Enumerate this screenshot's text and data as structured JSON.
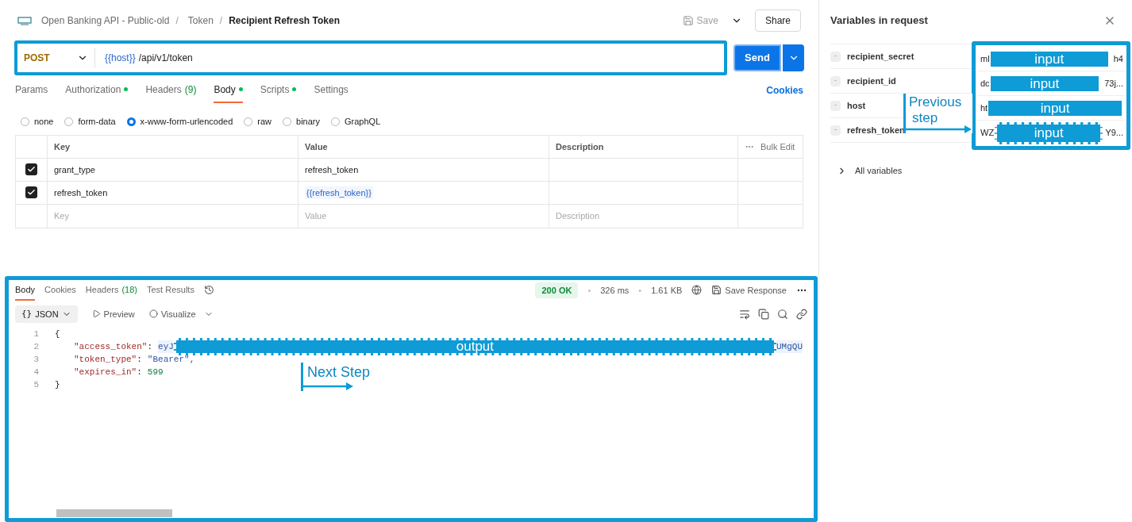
{
  "breadcrumb": {
    "items": [
      "Open Banking API - Public-old",
      "Token"
    ],
    "separator": "/",
    "current": "Recipient Refresh Token"
  },
  "actions": {
    "save": "Save",
    "share": "Share"
  },
  "request": {
    "method": "POST",
    "url_variable": "{{host}}",
    "url_path": "/api/v1/token",
    "send": "Send"
  },
  "request_tabs": [
    {
      "label": "Params",
      "dot": false,
      "selected": false
    },
    {
      "label": "Authorization",
      "dot": true,
      "selected": false
    },
    {
      "label": "Headers",
      "count": "(9)",
      "dot": false,
      "selected": false
    },
    {
      "label": "Body",
      "dot": true,
      "selected": true
    },
    {
      "label": "Scripts",
      "dot": true,
      "selected": false
    },
    {
      "label": "Settings",
      "dot": false,
      "selected": false
    }
  ],
  "cookies": "Cookies",
  "body_types": [
    {
      "label": "none",
      "selected": false
    },
    {
      "label": "form-data",
      "selected": false
    },
    {
      "label": "x-www-form-urlencoded",
      "selected": true
    },
    {
      "label": "raw",
      "selected": false
    },
    {
      "label": "binary",
      "selected": false
    },
    {
      "label": "GraphQL",
      "selected": false
    }
  ],
  "params_table": {
    "columns": [
      "Key",
      "Value",
      "Description"
    ],
    "bulk_edit": "Bulk Edit",
    "rows": [
      {
        "checked": true,
        "key": "grant_type",
        "value": "refresh_token",
        "kind": "text"
      },
      {
        "checked": true,
        "key": "refresh_token",
        "value": "{{refresh_token}}",
        "kind": "variable"
      }
    ],
    "placeholder": {
      "key": "Key",
      "value": "Value",
      "description": "Description"
    }
  },
  "response": {
    "tabs": [
      {
        "label": "Body",
        "selected": true
      },
      {
        "label": "Cookies",
        "selected": false
      },
      {
        "label": "Headers",
        "count": "(18)",
        "selected": false
      },
      {
        "label": "Test Results",
        "selected": false
      }
    ],
    "status": "200 OK",
    "separator": "•",
    "time": "326 ms",
    "size": "1.61 KB",
    "save_response": "Save Response",
    "format_icon": "{}",
    "format": "JSON",
    "preview": "Preview",
    "visualize": "Visualize",
    "lines": [
      {
        "number": "1",
        "kind": "brace",
        "text": "{"
      },
      {
        "number": "2",
        "kind": "pair",
        "key": "\"access_token\"",
        "colon": ":",
        "value_start": "eyJ",
        "value_end": "UMgQU",
        "annotation": "output"
      },
      {
        "number": "3",
        "kind": "pair",
        "key": "\"token_type\"",
        "colon": ":",
        "value": "\"Bearer\","
      },
      {
        "number": "4",
        "kind": "pair_number",
        "key": "\"expires_in\"",
        "colon": ":",
        "value": "599"
      },
      {
        "number": "5",
        "kind": "brace",
        "text": "}"
      }
    ],
    "next_step": "Next Step"
  },
  "variables_panel": {
    "title": "Variables in request",
    "rows": [
      {
        "tag": "-",
        "name": "recipient_secret",
        "value_start": "ml",
        "value_end": "h4",
        "annotation": "input",
        "dashed": false
      },
      {
        "tag": "-",
        "name": "recipient_id",
        "value_start": "dc",
        "value_end": "73j...",
        "annotation": "input",
        "dashed": false
      },
      {
        "tag": "-",
        "name": "host",
        "value_start": "ht",
        "annotation": "input",
        "dashed": false
      },
      {
        "tag": "-",
        "name": "refresh_token",
        "value_start": "WZ",
        "value_end": "Y9...",
        "annotation": "input",
        "dashed": true
      }
    ],
    "previous_step": [
      "Previous",
      "step"
    ],
    "all_variables": "All variables"
  }
}
